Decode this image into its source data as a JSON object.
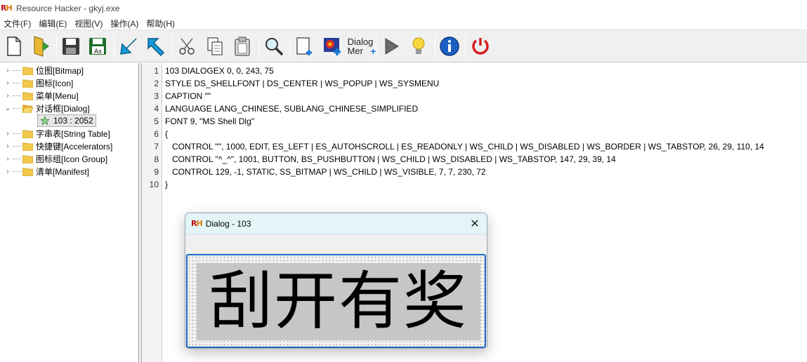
{
  "window": {
    "logo_text": "RH",
    "title": "Resource Hacker - gkyj.exe"
  },
  "menu": [
    "文件(F)",
    "编辑(E)",
    "视图(V)",
    "操作(A)",
    "帮助(H)"
  ],
  "toolbar": {
    "dialog_menu_label_line1": "Dialog",
    "dialog_menu_label_line2": "Mer"
  },
  "tree": {
    "items": [
      {
        "label": "位图[Bitmap]",
        "expanded": false
      },
      {
        "label": "图标[Icon]",
        "expanded": false
      },
      {
        "label": "菜单[Menu]",
        "expanded": false
      },
      {
        "label": "对话框[Dialog]",
        "expanded": true
      },
      {
        "label": "字串表[String Table]",
        "expanded": false
      },
      {
        "label": "快捷键[Accelerators]",
        "expanded": false
      },
      {
        "label": "图标组[Icon Group]",
        "expanded": false
      },
      {
        "label": "清单[Manifest]",
        "expanded": false
      }
    ],
    "selected_child": "103 : 2052"
  },
  "editor": {
    "line_numbers": [
      "1",
      "2",
      "3",
      "4",
      "5",
      "6",
      "7",
      "8",
      "9",
      "10"
    ],
    "lines": [
      "103 DIALOGEX 0, 0, 243, 75",
      "STYLE DS_SHELLFONT | DS_CENTER | WS_POPUP | WS_SYSMENU",
      "CAPTION \"\"",
      "LANGUAGE LANG_CHINESE, SUBLANG_CHINESE_SIMPLIFIED",
      "FONT 9, \"MS Shell Dlg\"",
      "{",
      "   CONTROL \"\", 1000, EDIT, ES_LEFT | ES_AUTOHSCROLL | ES_READONLY | WS_CHILD | WS_DISABLED | WS_BORDER | WS_TABSTOP, 26, 29, 110, 14",
      "   CONTROL \"^_^\", 1001, BUTTON, BS_PUSHBUTTON | WS_CHILD | WS_DISABLED | WS_TABSTOP, 147, 29, 39, 14",
      "   CONTROL 129, -1, STATIC, SS_BITMAP | WS_CHILD | WS_VISIBLE, 7, 7, 230, 72",
      "}"
    ]
  },
  "dialog_preview": {
    "logo_text": "RH",
    "title": "Dialog - 103",
    "close_glyph": "✕",
    "bitmap_text": "刮开有奖"
  },
  "colors": {
    "selection_border": "#1d6cc8",
    "dialog_titlebar": "#e4f5f8",
    "folder_yellow": "#f2c94c"
  }
}
